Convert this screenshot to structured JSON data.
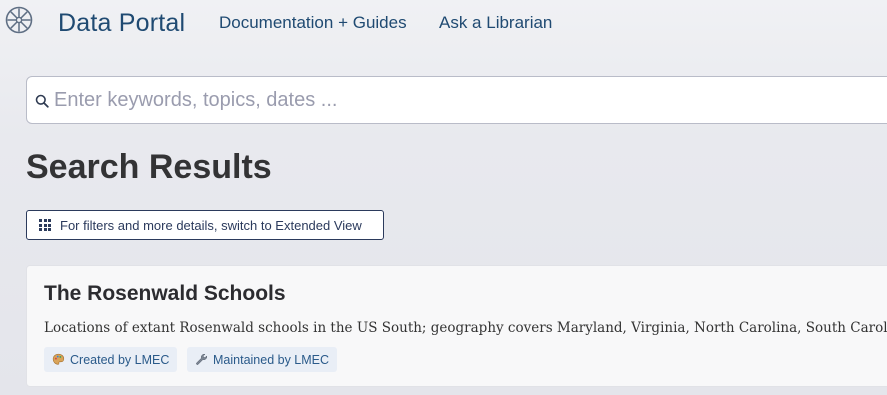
{
  "header": {
    "brand": "Data Portal",
    "nav": [
      {
        "label": "Documentation + Guides"
      },
      {
        "label": "Ask a Librarian"
      }
    ],
    "logo_icon": "compass-rose-icon"
  },
  "search": {
    "placeholder": "Enter keywords, topics, dates ...",
    "value": "",
    "icon": "search-icon"
  },
  "results": {
    "title": "Search Results",
    "view_toggle_label": "For filters and more details, switch to Extended View",
    "view_toggle_icon": "grid-icon",
    "items": [
      {
        "title": "The Rosenwald Schools",
        "description": "Locations of extant Rosenwald schools in the US South; geography covers Maryland, Virginia, North Carolina, South Carol",
        "tags": [
          {
            "label": "Created by LMEC",
            "icon": "palette-icon"
          },
          {
            "label": "Maintained by LMEC",
            "icon": "wrench-icon"
          }
        ]
      }
    ]
  },
  "colors": {
    "brand": "#1f4a72",
    "tag_text": "#2a5a8a",
    "tag_bg": "#e9eef6",
    "button_border": "#2b3a5c"
  }
}
